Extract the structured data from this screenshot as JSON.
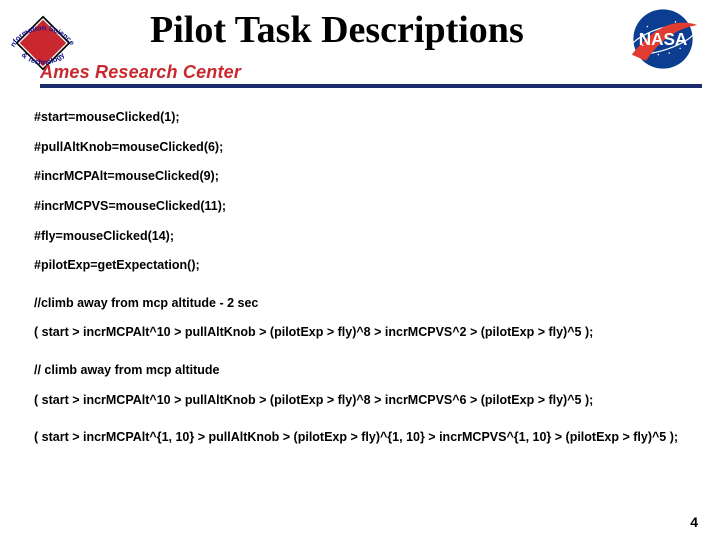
{
  "header": {
    "title": "Pilot Task Descriptions",
    "ames_label": "Ames Research Center",
    "ist_label": "Information Sciences & Technology",
    "nasa_label": "NASA"
  },
  "lines": [
    "#start=mouseClicked(1);",
    "#pullAltKnob=mouseClicked(6);",
    "#incrMCPAlt=mouseClicked(9);",
    "#incrMCPVS=mouseClicked(11);",
    "#fly=mouseClicked(14);",
    "#pilotExp=getExpectation();",
    "//climb away from mcp altitude - 2 sec",
    "( start > incrMCPAlt^10 > pullAltKnob > (pilotExp > fly)^8 > incrMCPVS^2 > (pilotExp > fly)^5 );",
    "// climb away from mcp altitude",
    "( start > incrMCPAlt^10 > pullAltKnob > (pilotExp > fly)^8 > incrMCPVS^6 > (pilotExp > fly)^5 );",
    "( start > incrMCPAlt^{1, 10} > pullAltKnob > (pilotExp > fly)^{1, 10} > incrMCPVS^{1, 10} > (pilotExp > fly)^5 );"
  ],
  "page_number": "4"
}
